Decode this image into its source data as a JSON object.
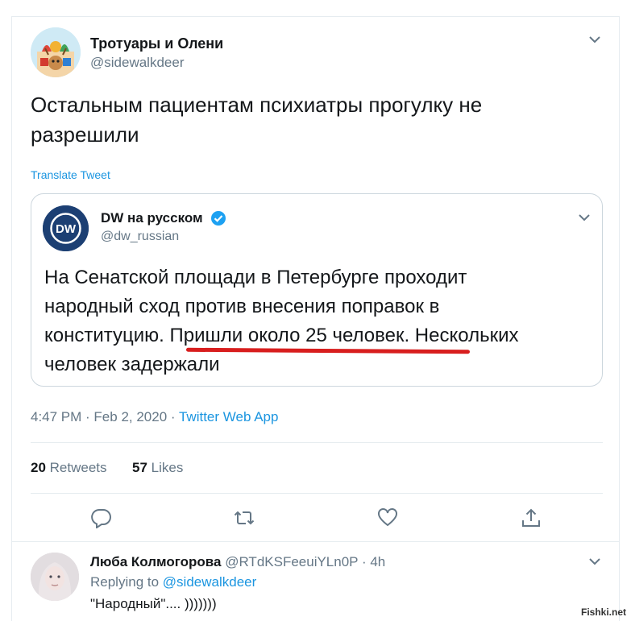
{
  "tweet": {
    "author_name": "Тротуары и Олени",
    "author_handle": "@sidewalkdeer",
    "text_line1": "Остальным пациентам психиатры прогулку не",
    "text_line2": "разрешили",
    "translate_label": "Translate Tweet",
    "time": "4:47 PM",
    "date_separator": " · ",
    "date": "Feb 2, 2020",
    "app_separator": " · ",
    "app": "Twitter Web App",
    "retweets_count": "20",
    "retweets_label": "Retweets",
    "likes_count": "57",
    "likes_label": "Likes"
  },
  "quote": {
    "author_name": "DW на русском",
    "author_handle": "@dw_russian",
    "avatar_text": "DW",
    "line1": "На Сенатской площади в Петербурге проходит",
    "line2": "народный сход против внесения поправок в",
    "line3a": "конституцию. ",
    "line3b": "Пришли около 25 человек.",
    "line3c": " Нескольких",
    "line4": "человек задержали"
  },
  "actions": {
    "reply_icon": "reply-icon",
    "retweet_icon": "retweet-icon",
    "like_icon": "heart-icon",
    "share_icon": "share-icon"
  },
  "reply": {
    "author_name": "Люба Колмогорова",
    "author_handle": "@RTdKSFeeuiYLn0P",
    "separator": " · ",
    "time_ago": "4h",
    "replying_label": "Replying to",
    "replying_to": "@sidewalkdeer",
    "text": "\"Народный\".... )))))))"
  },
  "watermark": "Fishki.net",
  "colors": {
    "link_blue": "#1b95e0",
    "secondary_gray": "#657786",
    "border_gray": "#e6ecf0",
    "underline_red": "#d81e1e",
    "dw_blue": "#1c3f73"
  }
}
